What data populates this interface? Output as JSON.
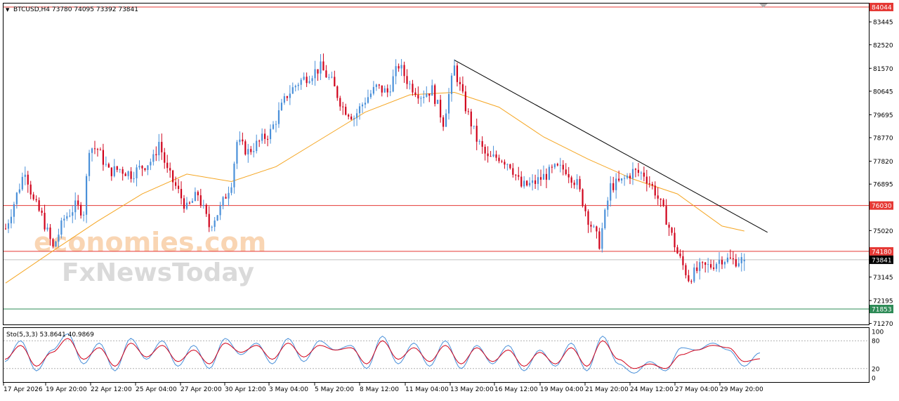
{
  "header": {
    "symbol_line": "BTCUSD,H4  73780 74095 73392 73841"
  },
  "watermark": {
    "line1": "economies.com",
    "line2": "FxNewsToday"
  },
  "price_axis": {
    "ticks": [
      "83445",
      "82520",
      "81570",
      "80645",
      "79695",
      "78770",
      "77820",
      "76895",
      "75020",
      "73145",
      "72195",
      "71270"
    ],
    "badges": [
      {
        "label": "84044",
        "value": 84044,
        "color": "#e53935",
        "text_color": "#ffffff"
      },
      {
        "label": "76030",
        "value": 76030,
        "color": "#e53935",
        "text_color": "#ffffff"
      },
      {
        "label": "74180",
        "value": 74180,
        "color": "#e53935",
        "text_color": "#ffffff"
      },
      {
        "label": "73841",
        "value": 73841,
        "color": "#000000",
        "text_color": "#ffffff"
      },
      {
        "label": "71853",
        "value": 71853,
        "color": "#2e8b57",
        "text_color": "#ffffff"
      }
    ]
  },
  "stochastic": {
    "label": "Sto(5,3,3) 53.8641 40.9869",
    "ticks": [
      "100",
      "80",
      "20",
      "0"
    ]
  },
  "time_axis": {
    "labels": [
      "17 Apr 2026",
      "19 Apr 20:00",
      "22 Apr 12:00",
      "25 Apr 04:00",
      "27 Apr 20:00",
      "30 Apr 12:00",
      "3 May 04:00",
      "5 May 20:00",
      "8 May 12:00",
      "11 May 04:00",
      "13 May 20:00",
      "16 May 12:00",
      "19 May 04:00",
      "21 May 20:00",
      "24 May 12:00",
      "27 May 04:00",
      "29 May 20:00"
    ]
  },
  "chart_data": [
    {
      "type": "candlestick",
      "title": "BTCUSD,H4",
      "last_bar": {
        "open": 73780,
        "high": 74095,
        "low": 73392,
        "close": 73841
      },
      "ylim": [
        71000,
        84100
      ],
      "colors": {
        "bull": "#4a90d9",
        "bear": "#d0021b",
        "ma": "#f5a623",
        "trendline": "#000000",
        "resistance": "#e53935",
        "support": "#2e8b57"
      },
      "horizontal_levels": [
        {
          "value": 84044,
          "color": "#e53935"
        },
        {
          "value": 76030,
          "color": "#e53935"
        },
        {
          "value": 74180,
          "color": "#e53935"
        },
        {
          "value": 71853,
          "color": "#2e8b57"
        }
      ],
      "trendline": [
        {
          "x": "13 May 20:00",
          "y": 81900
        },
        {
          "x": "31 May 04:00",
          "y": 74950
        }
      ],
      "close_path": [
        [
          "17 Apr 2026",
          75100
        ],
        [
          "18 Apr 04:00",
          77500
        ],
        [
          "18 Apr 16:00",
          76200
        ],
        [
          "19 Apr 04:00",
          75600
        ],
        [
          "19 Apr 20:00",
          74300
        ],
        [
          "20 Apr 12:00",
          75500
        ],
        [
          "21 Apr 04:00",
          76000
        ],
        [
          "21 Apr 16:00",
          75800
        ],
        [
          "22 Apr 00:00",
          78400
        ],
        [
          "22 Apr 12:00",
          78300
        ],
        [
          "23 Apr 04:00",
          77400
        ],
        [
          "23 Apr 20:00",
          77500
        ],
        [
          "24 Apr 12:00",
          77300
        ],
        [
          "25 Apr 04:00",
          77600
        ],
        [
          "25 Apr 20:00",
          77900
        ],
        [
          "26 Apr 04:00",
          78600
        ],
        [
          "26 Apr 16:00",
          77400
        ],
        [
          "27 Apr 04:00",
          76800
        ],
        [
          "27 Apr 20:00",
          75900
        ],
        [
          "28 Apr 12:00",
          76500
        ],
        [
          "29 Apr 04:00",
          75200
        ],
        [
          "29 Apr 20:00",
          75900
        ],
        [
          "30 Apr 12:00",
          77000
        ],
        [
          "30 Apr 20:00",
          78600
        ],
        [
          "1 May 12:00",
          78200
        ],
        [
          "2 May 04:00",
          78600
        ],
        [
          "2 May 20:00",
          79000
        ],
        [
          "3 May 04:00",
          79500
        ],
        [
          "3 May 20:00",
          80500
        ],
        [
          "4 May 12:00",
          81000
        ],
        [
          "5 May 04:00",
          81300
        ],
        [
          "5 May 20:00",
          81600
        ],
        [
          "6 May 12:00",
          81000
        ],
        [
          "7 May 04:00",
          80000
        ],
        [
          "7 May 20:00",
          79600
        ],
        [
          "8 May 12:00",
          80300
        ],
        [
          "9 May 04:00",
          80800
        ],
        [
          "9 May 20:00",
          80600
        ],
        [
          "10 May 12:00",
          81700
        ],
        [
          "10 May 20:00",
          81300
        ],
        [
          "11 May 04:00",
          80900
        ],
        [
          "11 May 20:00",
          80500
        ],
        [
          "12 May 12:00",
          80700
        ],
        [
          "13 May 04:00",
          79400
        ],
        [
          "13 May 20:00",
          81600
        ],
        [
          "14 May 12:00",
          80000
        ],
        [
          "15 May 04:00",
          78700
        ],
        [
          "15 May 20:00",
          77900
        ],
        [
          "16 May 12:00",
          78000
        ],
        [
          "17 May 04:00",
          77700
        ],
        [
          "17 May 20:00",
          76800
        ],
        [
          "18 May 12:00",
          76900
        ],
        [
          "19 May 04:00",
          77200
        ],
        [
          "19 May 20:00",
          77500
        ],
        [
          "20 May 12:00",
          77500
        ],
        [
          "21 May 04:00",
          76900
        ],
        [
          "21 May 20:00",
          75500
        ],
        [
          "22 May 12:00",
          74500
        ],
        [
          "23 May 04:00",
          76800
        ],
        [
          "23 May 20:00",
          77000
        ],
        [
          "24 May 12:00",
          77400
        ],
        [
          "25 May 04:00",
          77300
        ],
        [
          "25 May 20:00",
          76600
        ],
        [
          "26 May 12:00",
          75500
        ],
        [
          "27 May 04:00",
          74100
        ],
        [
          "27 May 20:00",
          73100
        ],
        [
          "28 May 12:00",
          73500
        ],
        [
          "29 May 04:00",
          73600
        ],
        [
          "29 May 20:00",
          73900
        ],
        [
          "30 May 12:00",
          73800
        ],
        [
          "31 May 04:00",
          73841
        ]
      ],
      "ma_path": [
        [
          "17 Apr 2026",
          72900
        ],
        [
          "19 Apr 20:00",
          74200
        ],
        [
          "22 Apr 12:00",
          75400
        ],
        [
          "25 Apr 04:00",
          76500
        ],
        [
          "27 Apr 20:00",
          77300
        ],
        [
          "30 Apr 12:00",
          77000
        ],
        [
          "3 May 04:00",
          77600
        ],
        [
          "5 May 20:00",
          78700
        ],
        [
          "8 May 12:00",
          79800
        ],
        [
          "11 May 04:00",
          80500
        ],
        [
          "13 May 20:00",
          80600
        ],
        [
          "16 May 12:00",
          80000
        ],
        [
          "19 May 04:00",
          78800
        ],
        [
          "21 May 20:00",
          77900
        ],
        [
          "24 May 12:00",
          77100
        ],
        [
          "27 May 04:00",
          76500
        ],
        [
          "29 May 20:00",
          75200
        ],
        [
          "31 May 04:00",
          75000
        ]
      ]
    },
    {
      "type": "line",
      "title": "Sto(5,3,3)",
      "ylim": [
        0,
        100
      ],
      "levels": [
        80,
        20
      ],
      "series": [
        {
          "name": "main",
          "color": "#4a90d9",
          "values": [
            35,
            80,
            15,
            60,
            95,
            30,
            75,
            15,
            85,
            40,
            80,
            25,
            70,
            20,
            85,
            50,
            75,
            30,
            85,
            35,
            80,
            60,
            70,
            20,
            90,
            30,
            75,
            25,
            80,
            20,
            70,
            30,
            70,
            15,
            60,
            25,
            75,
            15,
            90,
            30,
            10,
            35,
            15,
            65,
            60,
            75,
            60,
            25,
            54
          ]
        },
        {
          "name": "signal",
          "color": "#d0021b",
          "values": [
            40,
            70,
            25,
            55,
            85,
            40,
            65,
            25,
            75,
            45,
            70,
            35,
            60,
            30,
            75,
            55,
            70,
            40,
            75,
            45,
            70,
            60,
            65,
            30,
            80,
            40,
            65,
            35,
            70,
            30,
            65,
            35,
            60,
            25,
            55,
            30,
            65,
            25,
            80,
            40,
            20,
            30,
            20,
            50,
            60,
            70,
            65,
            35,
            41
          ]
        }
      ]
    }
  ]
}
